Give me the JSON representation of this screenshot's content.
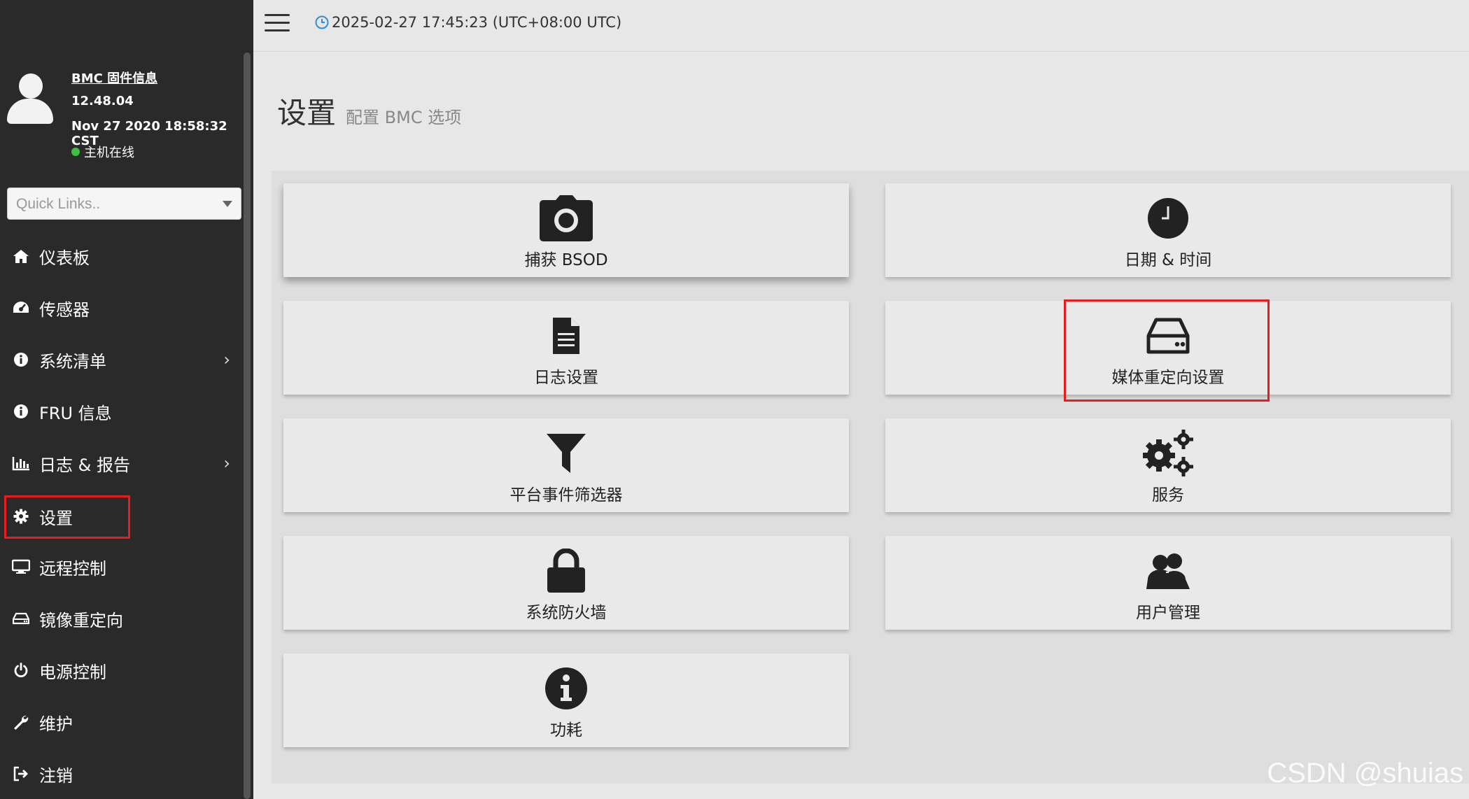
{
  "colors": {
    "sidebar_bg": "#2a2a2a",
    "content_bg": "#e7e7e7",
    "highlight": "#e81c1c",
    "status_online": "#3fbf3f"
  },
  "topbar": {
    "datetime": "2025-02-27 17:45:23 (UTC+08:00 UTC)",
    "menu_icon": "hamburger-icon",
    "clock_icon": "clock-icon"
  },
  "profile": {
    "title": "BMC 固件信息",
    "version": "12.48.04",
    "build_date": "Nov 27 2020 18:58:32 CST",
    "host_status": "主机在线"
  },
  "quick_links": {
    "placeholder": "Quick Links.."
  },
  "sidebar": {
    "items": [
      {
        "label": "仪表板",
        "icon": "home-icon"
      },
      {
        "label": "传感器",
        "icon": "dashboard-gauge-icon"
      },
      {
        "label": "系统清单",
        "icon": "info-icon",
        "has_submenu": true
      },
      {
        "label": "FRU 信息",
        "icon": "info-icon"
      },
      {
        "label": "日志 & 报告",
        "icon": "bar-chart-icon",
        "has_submenu": true
      },
      {
        "label": "设置",
        "icon": "gear-icon",
        "active": true
      },
      {
        "label": "远程控制",
        "icon": "monitor-icon"
      },
      {
        "label": "镜像重定向",
        "icon": "hdd-icon"
      },
      {
        "label": "电源控制",
        "icon": "power-icon"
      },
      {
        "label": "维护",
        "icon": "wrench-icon"
      },
      {
        "label": "注销",
        "icon": "sign-out-icon"
      }
    ]
  },
  "page": {
    "title": "设置",
    "subtitle": "配置 BMC 选项"
  },
  "tiles": [
    {
      "label": "捕获 BSOD",
      "icon": "camera-icon"
    },
    {
      "label": "日期 & 时间",
      "icon": "clock-icon"
    },
    {
      "label": "日志设置",
      "icon": "file-text-icon"
    },
    {
      "label": "媒体重定向设置",
      "icon": "hdd-icon",
      "highlighted": true
    },
    {
      "label": "平台事件筛选器",
      "icon": "filter-icon"
    },
    {
      "label": "服务",
      "icon": "gears-icon"
    },
    {
      "label": "系统防火墙",
      "icon": "lock-icon"
    },
    {
      "label": "用户管理",
      "icon": "users-icon"
    },
    {
      "label": "功耗",
      "icon": "info-circle-icon"
    }
  ],
  "watermark": "CSDN @shuias"
}
